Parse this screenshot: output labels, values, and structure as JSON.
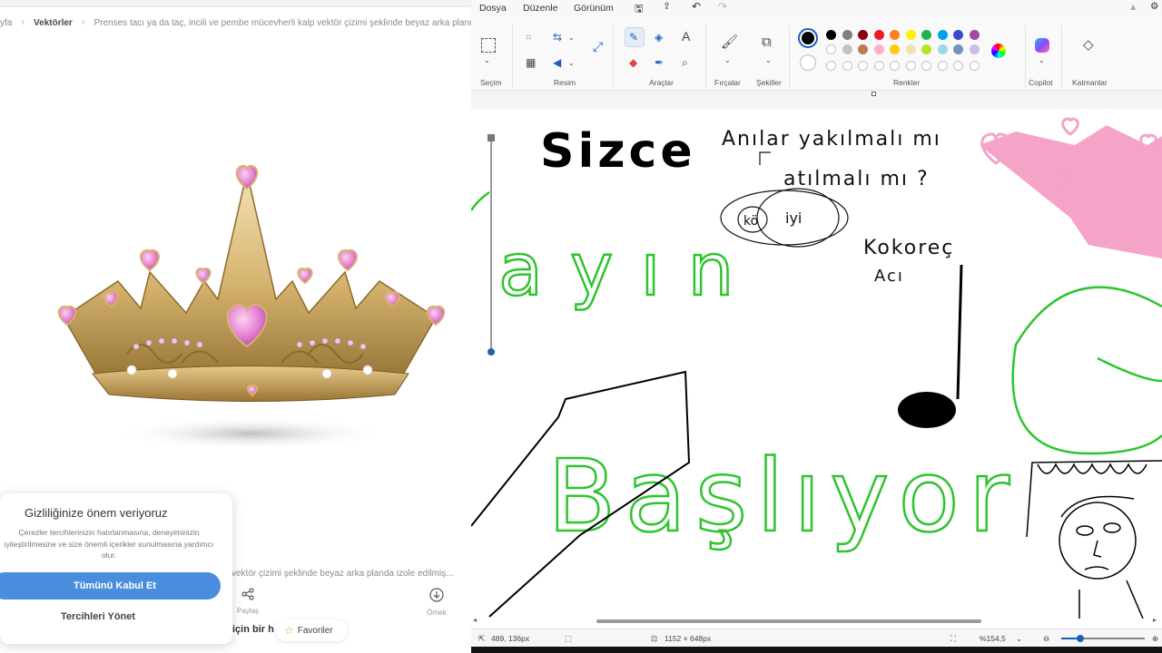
{
  "left": {
    "breadcrumb": {
      "home": "yfa",
      "section": "Vektörler",
      "title": "Prenses tacı ya da taç, incili ve pembe mücevherli kalp vektör çizimi şeklinde beyaz arka planda"
    },
    "privacy": {
      "title": "Gizliliğinize önem veriyoruz",
      "text": "Çerezler tercihlerinizin hatırlanmasına, deneyiminizin iyileştirilmesine ve size önemli içerikler sunulmasına yardımcı olur.",
      "accept_label": "Tümünü Kabul Et",
      "manage_label": "Tercihleri Yönet"
    },
    "caption": "vektör çizimi şeklinde beyaz arka planda izole edilmiş...",
    "share_label": "Paylaş",
    "sample_label": "Örnek",
    "buy_text": "için bir h",
    "favorites_label": "Favoriler"
  },
  "paint": {
    "menu": [
      "Dosya",
      "Düzenle",
      "Görünüm"
    ],
    "groups": {
      "selection": "Seçim",
      "image": "Resim",
      "tools": "Araçlar",
      "brushes": "Fırçalar",
      "shapes": "Şekiller",
      "colors": "Renkler",
      "copilot": "Copilot",
      "layers": "Katmanlar"
    },
    "colors": {
      "row1": [
        "#000000",
        "#7f7f7f",
        "#880015",
        "#ed1c24",
        "#ff7f27",
        "#fff200",
        "#22b14c",
        "#00a2e8",
        "#3f48cc",
        "#a349a4"
      ],
      "row2": [
        "#ffffff",
        "#c3c3c3",
        "#b97a57",
        "#ffaec9",
        "#ffc90e",
        "#efe4b0",
        "#b5e61d",
        "#99d9ea",
        "#7092be",
        "#c8bfe7"
      ],
      "active": "#000000"
    },
    "status": {
      "cursor_pos": "489, 136px",
      "canvas_size": "1152 × 648px",
      "zoom": "%154,5"
    },
    "drawing": {
      "word1": "Sizce",
      "note1": "Anılar yakılmalı mı",
      "note2": "atılmalı mı ?",
      "circle_a": "kö",
      "circle_b": "iyi",
      "note3": "Kokoreç",
      "note4": "Acı",
      "green1": "ayın",
      "green2": "Başlıyor"
    }
  }
}
